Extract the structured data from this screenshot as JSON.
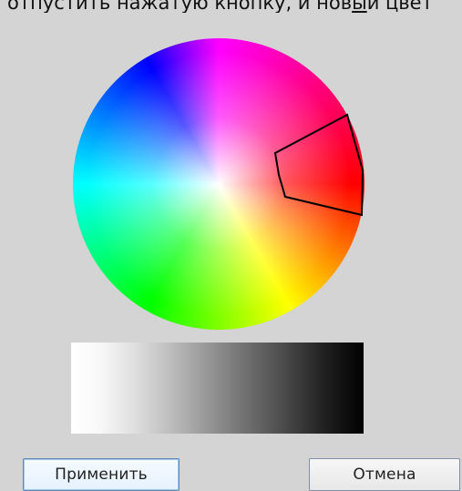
{
  "top_instruction": {
    "prefix": "отпустить нажатую кнопку, и нов",
    "underlined": "ы",
    "suffix": "й цвет"
  },
  "dialog": {
    "buttons": {
      "apply": "Применить",
      "cancel": "Отмена"
    },
    "colors": {
      "background": "#d4d4d4",
      "apply_border": "#5f89b8",
      "selection_outline": "#000000"
    }
  }
}
